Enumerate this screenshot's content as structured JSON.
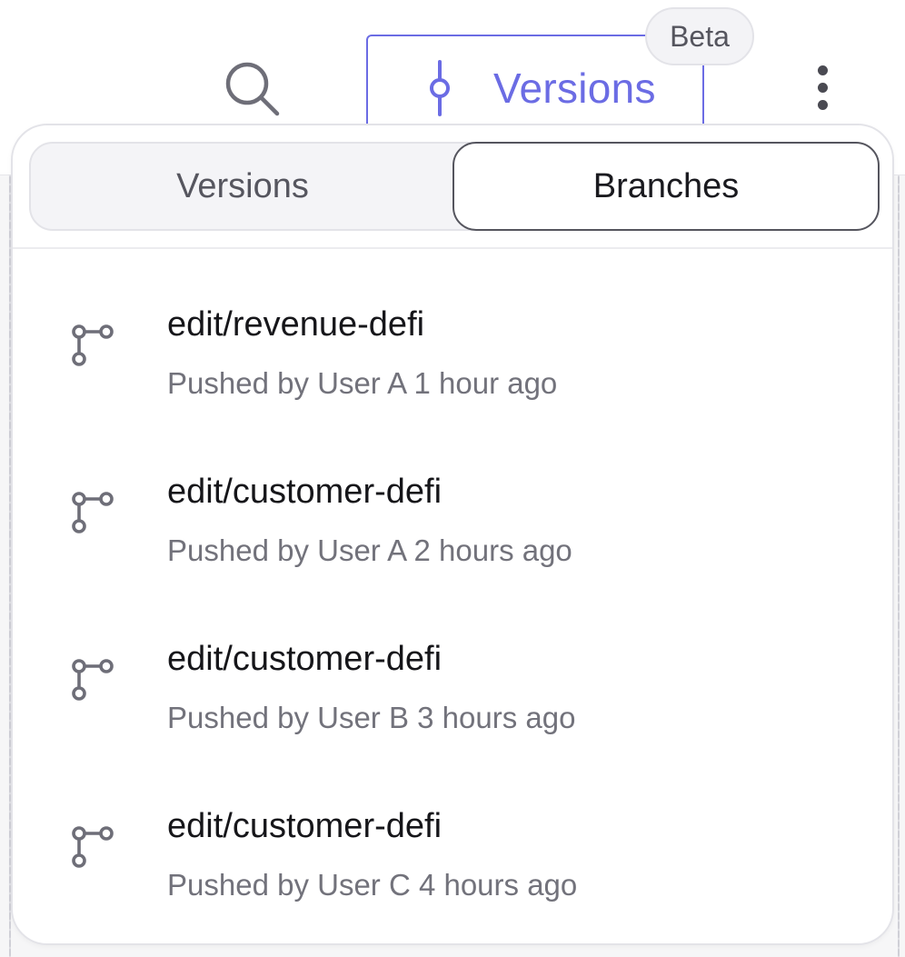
{
  "toolbar": {
    "search_icon": "search-icon",
    "versions_label": "Versions",
    "beta_label": "Beta",
    "more_icon": "more-vertical-icon"
  },
  "tabs": [
    {
      "label": "Versions",
      "selected": false
    },
    {
      "label": "Branches",
      "selected": true
    }
  ],
  "branches": [
    {
      "name": "edit/revenue-defi",
      "meta": "Pushed by User A 1 hour ago"
    },
    {
      "name": "edit/customer-defi",
      "meta": "Pushed by User A 2 hours ago"
    },
    {
      "name": "edit/customer-defi",
      "meta": "Pushed by User B 3 hours ago"
    },
    {
      "name": "edit/customer-defi",
      "meta": "Pushed by User C 4 hours ago"
    }
  ],
  "colors": {
    "accent": "#6b6ce4",
    "text_primary": "#16161a",
    "text_secondary": "#72727b",
    "icon_gray": "#6e6e78"
  }
}
